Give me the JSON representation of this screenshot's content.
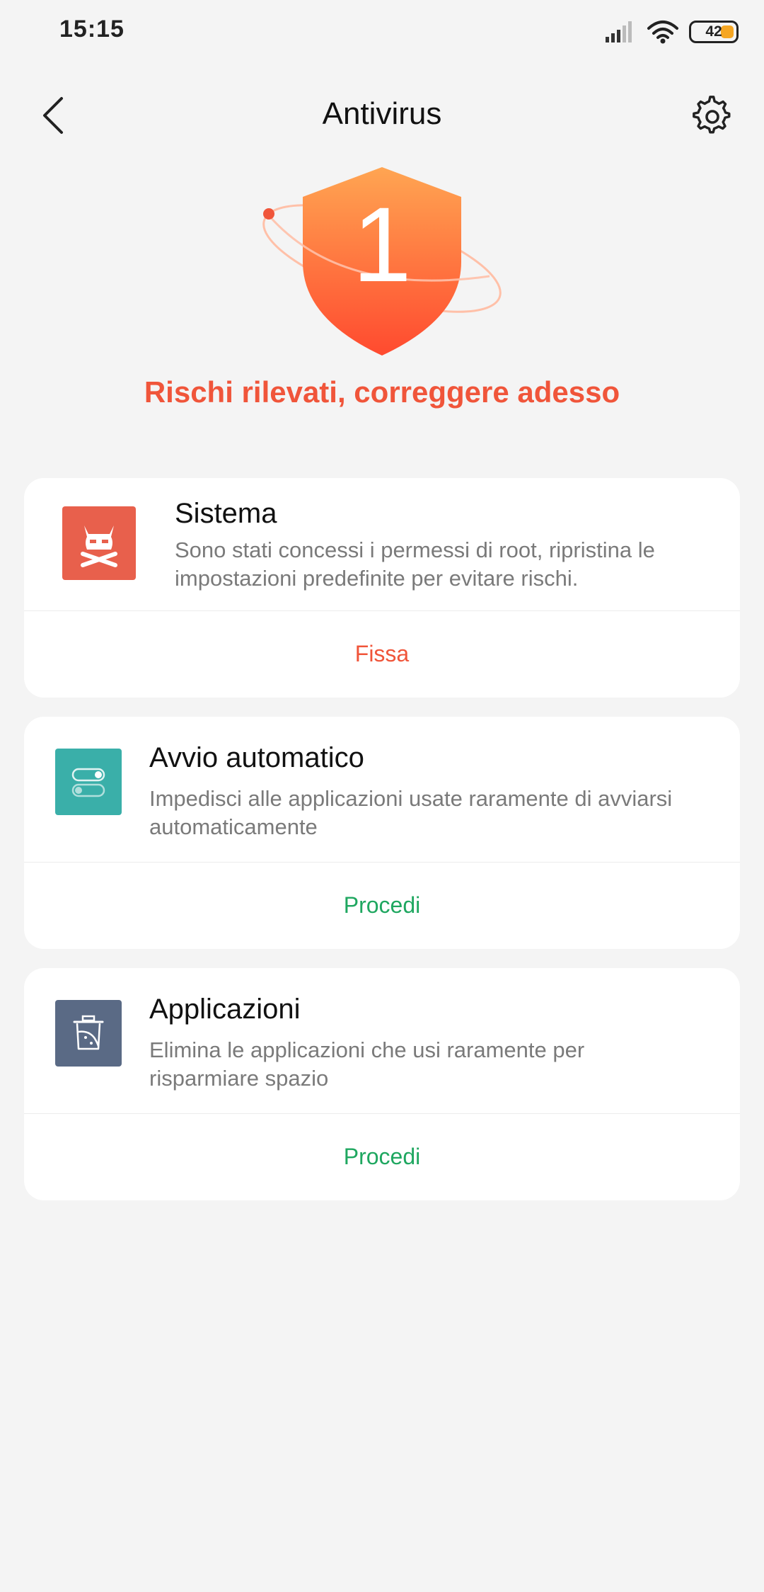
{
  "status": {
    "time": "15:15",
    "battery": "42"
  },
  "header": {
    "title": "Antivirus",
    "back_icon": "chevron-left-icon",
    "settings_icon": "gear-icon"
  },
  "hero": {
    "count": "1",
    "message": "Rischi rilevati, correggere adesso",
    "accent": "#f0553a"
  },
  "cards": [
    {
      "title": "Sistema",
      "description": "Sono stati concessi i permessi di root, ripristina le impostazioni predefinite per evitare rischi.",
      "action": "Fissa",
      "icon": "root-devil-icon",
      "icon_color": "#e8604c",
      "action_color": "#f0553a"
    },
    {
      "title": "Avvio automatico",
      "description": "Impedisci alle applicazioni usate raramente di avviarsi automaticamente",
      "action": "Procedi",
      "icon": "toggle-switches-icon",
      "icon_color": "#3aafa9",
      "action_color": "#1fa760"
    },
    {
      "title": "Applicazioni",
      "description": "Elimina le applicazioni che usi raramente per risparmiare spazio",
      "action": "Procedi",
      "icon": "trash-can-icon",
      "icon_color": "#5a6a85",
      "action_color": "#1fa760"
    }
  ]
}
